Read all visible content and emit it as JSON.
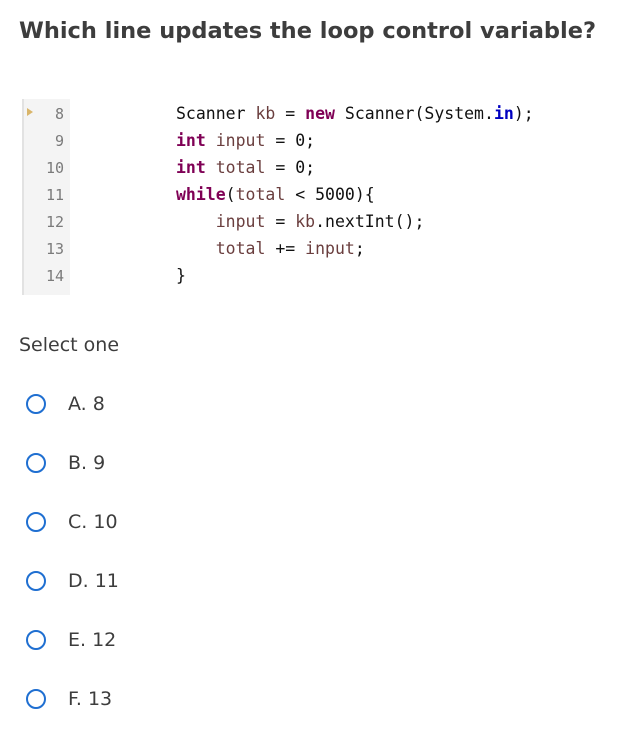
{
  "question": "Which line updates the loop control variable?",
  "code": {
    "line_numbers": [
      "8",
      "9",
      "10",
      "11",
      "12",
      "13",
      "14"
    ],
    "lines": [
      [
        {
          "t": "Scanner ",
          "c": "plain"
        },
        {
          "t": "kb",
          "c": "var"
        },
        {
          "t": " = ",
          "c": "plain"
        },
        {
          "t": "new",
          "c": "kw"
        },
        {
          "t": " Scanner(System.",
          "c": "plain"
        },
        {
          "t": "in",
          "c": "field"
        },
        {
          "t": ");",
          "c": "plain"
        }
      ],
      [
        {
          "t": "int",
          "c": "kw"
        },
        {
          "t": " ",
          "c": "plain"
        },
        {
          "t": "input",
          "c": "var"
        },
        {
          "t": " = 0;",
          "c": "plain"
        }
      ],
      [
        {
          "t": "int",
          "c": "kw"
        },
        {
          "t": " ",
          "c": "plain"
        },
        {
          "t": "total",
          "c": "var"
        },
        {
          "t": " = 0;",
          "c": "plain"
        }
      ],
      [
        {
          "t": "while",
          "c": "kw"
        },
        {
          "t": "(",
          "c": "plain"
        },
        {
          "t": "total",
          "c": "var"
        },
        {
          "t": " < 5000){",
          "c": "plain"
        }
      ],
      [
        {
          "t": "    ",
          "c": "plain"
        },
        {
          "t": "input",
          "c": "var"
        },
        {
          "t": " = ",
          "c": "plain"
        },
        {
          "t": "kb",
          "c": "var"
        },
        {
          "t": ".nextInt();",
          "c": "plain"
        }
      ],
      [
        {
          "t": "    ",
          "c": "plain"
        },
        {
          "t": "total",
          "c": "var"
        },
        {
          "t": " += ",
          "c": "plain"
        },
        {
          "t": "input",
          "c": "var"
        },
        {
          "t": ";",
          "c": "plain"
        }
      ],
      [
        {
          "t": "}",
          "c": "plain"
        }
      ]
    ]
  },
  "select_label": "Select one",
  "options": [
    {
      "letter": "A.",
      "value": "8"
    },
    {
      "letter": "B.",
      "value": "9"
    },
    {
      "letter": "C.",
      "value": "10"
    },
    {
      "letter": "D.",
      "value": "11"
    },
    {
      "letter": "E.",
      "value": "12"
    },
    {
      "letter": "F.",
      "value": "13"
    }
  ],
  "colors": {
    "radio_border": "#1f6fd1",
    "keyword": "#7f0055",
    "variable": "#6a3e3e",
    "static_field": "#0000c0"
  }
}
